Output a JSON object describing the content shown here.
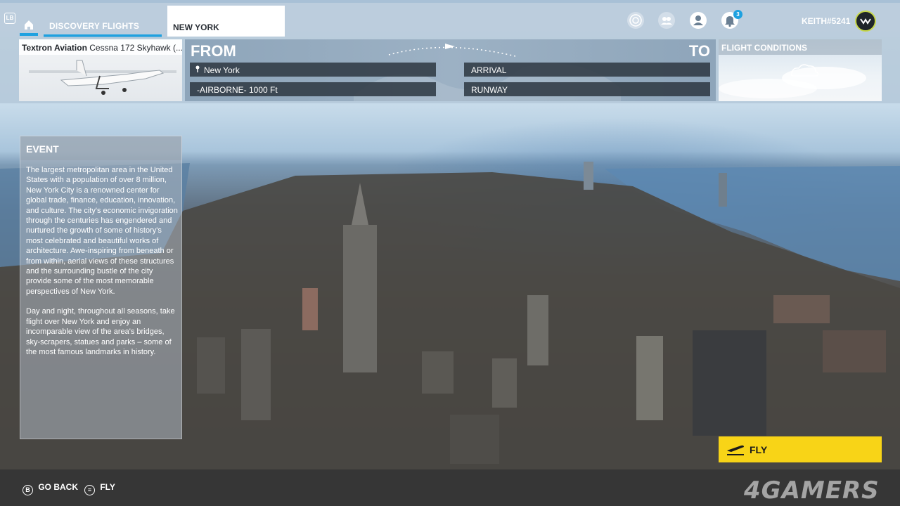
{
  "topbar": {
    "lb_badge": "LB",
    "tabs": [
      {
        "label": "DISCOVERY FLIGHTS"
      },
      {
        "label": "NEW YORK"
      }
    ],
    "notification_count": "3",
    "username": "KEITH#5241"
  },
  "aircraft": {
    "brand": "Textron Aviation",
    "model": "Cessna 172 Skyhawk (..."
  },
  "route": {
    "from_label": "FROM",
    "to_label": "TO",
    "from_location": "New York",
    "from_altitude": "-AIRBORNE- 1000 Ft",
    "to_arrival": "ARRIVAL",
    "to_runway": "RUNWAY"
  },
  "conditions": {
    "title": "FLIGHT CONDITIONS"
  },
  "event": {
    "title": "EVENT",
    "paragraph1": "The largest metropolitan area in the United States with a population of over 8 million, New York City is a renowned center for global trade, finance, education, innovation, and culture. The city's economic invigoration through the centuries has engendered and nurtured the growth of some of history's most celebrated and beautiful works of architecture. Awe-inspiring from beneath or from within, aerial views of these structures and the surrounding bustle of the city provide some of the most memorable perspectives of New York.",
    "paragraph2": "Day and night, throughout all seasons, take flight over New York and enjoy an incomparable view of the area's bridges, sky-scrapers, statues and parks – some of the most famous landmarks in history."
  },
  "fly_button": {
    "label": "FLY"
  },
  "bottombar": {
    "go_back": "GO BACK",
    "fly": "FLY",
    "b_glyph": "B",
    "menu_glyph": "≡"
  },
  "watermark": "4GAMERS",
  "colors": {
    "accent": "#1ea1e0",
    "fly_yellow": "#f8d417"
  }
}
